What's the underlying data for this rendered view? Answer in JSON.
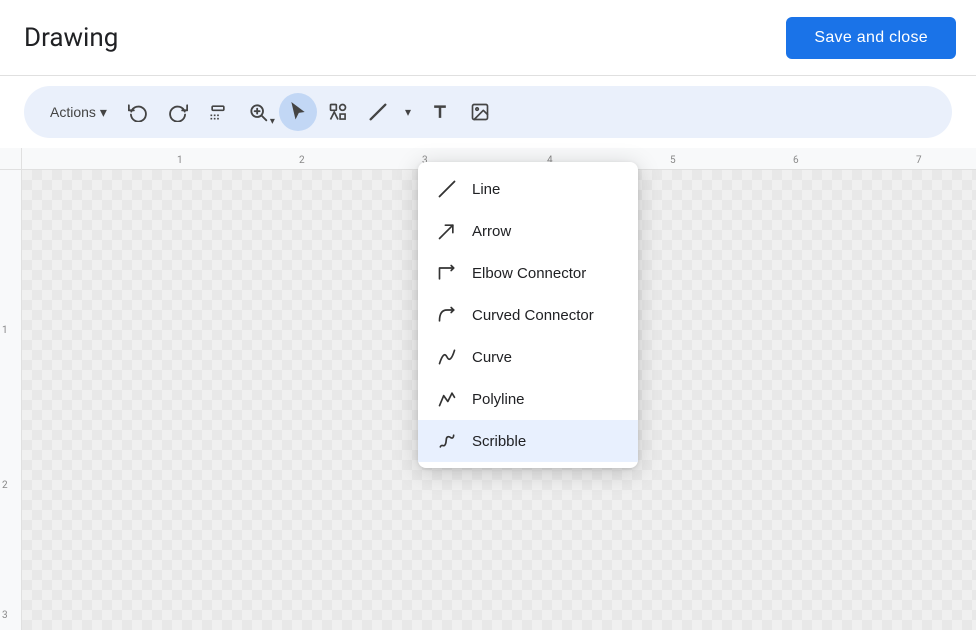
{
  "header": {
    "title": "Drawing",
    "save_close_label": "Save and close"
  },
  "toolbar": {
    "actions_label": "Actions",
    "actions_chevron": "▾",
    "buttons": [
      {
        "name": "undo",
        "icon": "↩",
        "title": "Undo"
      },
      {
        "name": "redo",
        "icon": "↪",
        "title": "Redo"
      },
      {
        "name": "paint-format",
        "icon": "🖌",
        "title": "Paint format"
      },
      {
        "name": "zoom",
        "icon": "🔍",
        "title": "Zoom"
      }
    ]
  },
  "dropdown": {
    "items": [
      {
        "name": "line",
        "label": "Line"
      },
      {
        "name": "arrow",
        "label": "Arrow"
      },
      {
        "name": "elbow-connector",
        "label": "Elbow Connector"
      },
      {
        "name": "curved-connector",
        "label": "Curved Connector"
      },
      {
        "name": "curve",
        "label": "Curve"
      },
      {
        "name": "polyline",
        "label": "Polyline"
      },
      {
        "name": "scribble",
        "label": "Scribble"
      }
    ]
  },
  "ruler": {
    "h_ticks": [
      "1",
      "2",
      "3",
      "4",
      "5",
      "6",
      "7"
    ],
    "v_ticks": [
      "1",
      "2",
      "3"
    ]
  },
  "colors": {
    "primary_blue": "#1a73e8",
    "toolbar_bg": "#eaf0fb",
    "active_tool": "#c2d7f5"
  }
}
